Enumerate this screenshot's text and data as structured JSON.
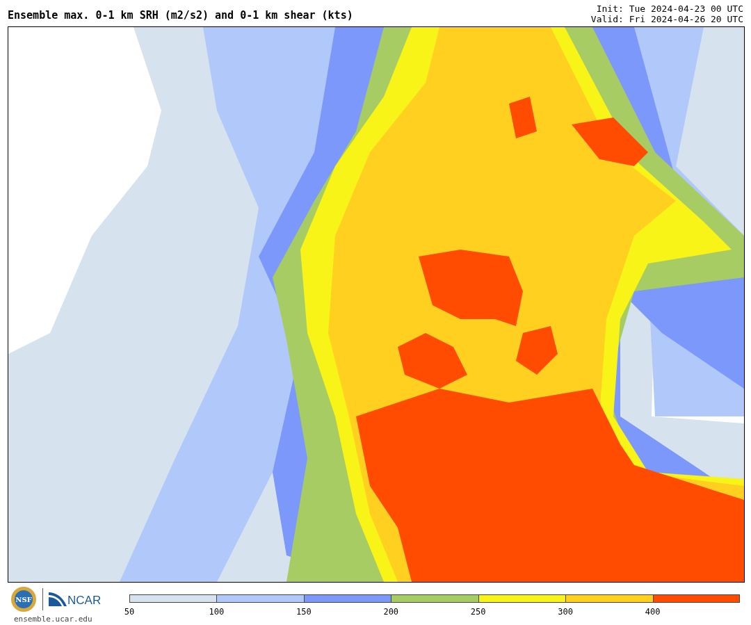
{
  "title": "Ensemble max. 0-1 km SRH (m2/s2) and 0-1 km shear (kts)",
  "init": "Init: Tue 2024-04-23 00 UTC",
  "valid": "Valid: Fri 2024-04-26 20 UTC",
  "logos": [
    {
      "kind": "nsf",
      "text": "NSF"
    },
    {
      "kind": "ncar",
      "text": "NCAR"
    }
  ],
  "site": "ensemble.ucar.edu",
  "legend": [
    {
      "label": "50",
      "color": "#d6e2ee"
    },
    {
      "label": "100",
      "color": "#b0c8fa"
    },
    {
      "label": "150",
      "color": "#7b98fa"
    },
    {
      "label": "200",
      "color": "#a8cc64"
    },
    {
      "label": "250",
      "color": "#f8f418"
    },
    {
      "label": "300",
      "color": "#ffd020"
    },
    {
      "label": "400",
      "color": "#ff4c00"
    }
  ]
}
